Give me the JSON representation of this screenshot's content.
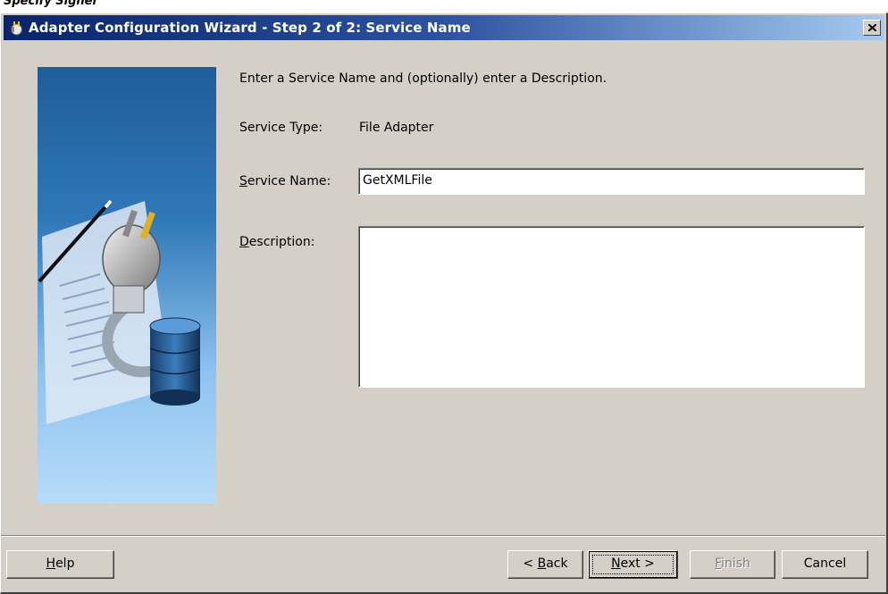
{
  "window": {
    "title": "Adapter Configuration Wizard - Step 2 of 2: Service Name",
    "top_text": "Specify Signer"
  },
  "form": {
    "instruction": "Enter a Service Name and (optionally) enter a Description.",
    "service_type_label": "Service Type:",
    "service_type_value": "File Adapter",
    "service_name_label_mnemonic": "S",
    "service_name_label_rest": "ervice Name:",
    "service_name_value": "GetXMLFile",
    "description_label_mnemonic": "D",
    "description_label_rest": "escription:",
    "description_value": ""
  },
  "buttons": {
    "help_m": "H",
    "help_rest": "elp",
    "back_pre": "< ",
    "back_m": "B",
    "back_rest": "ack",
    "next_m": "N",
    "next_rest": "ext >",
    "finish_m": "F",
    "finish_rest": "inish",
    "cancel": "Cancel"
  },
  "icons": {
    "title": "adapter-plug-icon",
    "close": "close-icon",
    "illustration": "plug-database-illustration"
  },
  "state": {
    "finish_enabled": false,
    "default_button": "next"
  },
  "colors": {
    "dialog_bg": "#d4d0c8",
    "title_start": "#0a246a",
    "title_end": "#a6caf0"
  }
}
